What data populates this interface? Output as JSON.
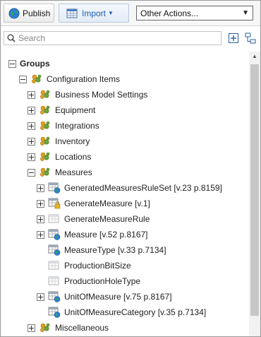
{
  "toolbar": {
    "publish_label": "Publish",
    "import_label": "Import",
    "other_actions": "Other Actions..."
  },
  "search": {
    "placeholder": "Search"
  },
  "tree": {
    "root": "Groups",
    "items": [
      {
        "label": "Configuration Items",
        "level": 1,
        "expander": "minus",
        "icon": "group-icon"
      },
      {
        "label": "Business Model Settings",
        "level": 2,
        "expander": "plus",
        "icon": "group-icon"
      },
      {
        "label": "Equipment",
        "level": 2,
        "expander": "plus",
        "icon": "group-icon"
      },
      {
        "label": "Integrations",
        "level": 2,
        "expander": "plus",
        "icon": "group-icon"
      },
      {
        "label": "Inventory",
        "level": 2,
        "expander": "plus",
        "icon": "group-icon"
      },
      {
        "label": "Locations",
        "level": 2,
        "expander": "plus",
        "icon": "group-icon"
      },
      {
        "label": "Measures",
        "level": 2,
        "expander": "minus",
        "icon": "group-icon"
      },
      {
        "label": "GeneratedMeasuresRuleSet [v.23 p.8159]",
        "level": 3,
        "expander": "plus",
        "icon": "table-globe-icon"
      },
      {
        "label": "GenerateMeasure [v.1]",
        "level": 3,
        "expander": "plus",
        "icon": "table-lock-icon"
      },
      {
        "label": "GenerateMeasureRule",
        "level": 3,
        "expander": "plus",
        "icon": "table-plain-icon"
      },
      {
        "label": "Measure [v.52 p.8167]",
        "level": 3,
        "expander": "plus",
        "icon": "table-globe-icon"
      },
      {
        "label": "MeasureType [v.33 p.7134]",
        "level": 3,
        "expander": "none",
        "icon": "table-globe-icon"
      },
      {
        "label": "ProductionBitSize",
        "level": 3,
        "expander": "none",
        "icon": "table-plain-icon"
      },
      {
        "label": "ProductionHoleType",
        "level": 3,
        "expander": "none",
        "icon": "table-plain-icon"
      },
      {
        "label": "UnitOfMeasure [v.75 p.8167]",
        "level": 3,
        "expander": "plus",
        "icon": "table-globe-icon"
      },
      {
        "label": "UnitOfMeasureCategory [v.35 p.7134]",
        "level": 3,
        "expander": "none",
        "icon": "table-globe-icon"
      },
      {
        "label": "Miscellaneous",
        "level": 2,
        "expander": "plus",
        "icon": "group-icon"
      }
    ]
  }
}
